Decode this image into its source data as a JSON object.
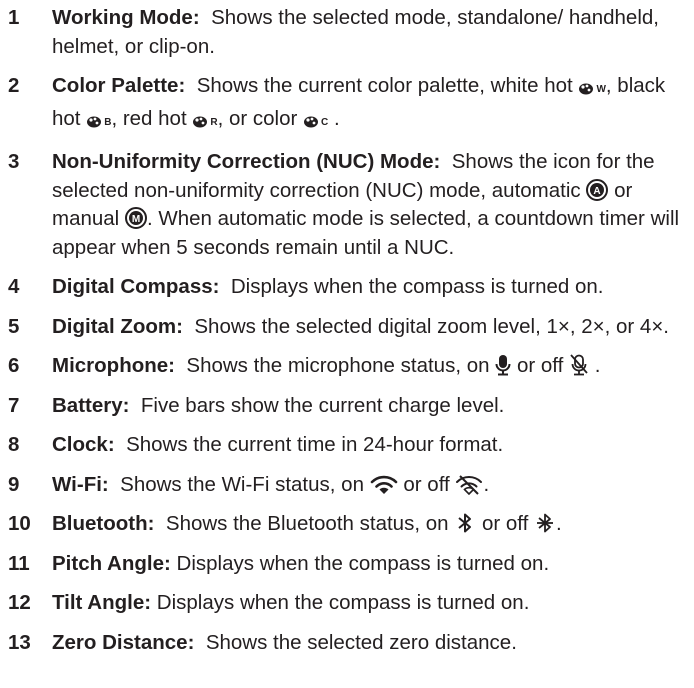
{
  "items": [
    {
      "num": "1",
      "label": "Working Mode:",
      "text": "Shows the selected mode, standalone/ handheld, helmet, or clip-on."
    },
    {
      "num": "2",
      "label": "Color Palette:",
      "t1": "Shows the current color palette, white hot",
      "t2": ",",
      "t3": "black hot",
      "t4": ", red hot",
      "t5": ", or color",
      "t6": ".",
      "icons": {
        "white": "W",
        "black": "B",
        "red": "R",
        "color": "C"
      }
    },
    {
      "num": "3",
      "label": "Non-Uniformity Correction (NUC) Mode:",
      "t1": "Shows the icon for the selected non-uniformity correction (NUC) mode,",
      "t2": "automatic",
      "t3": "or manual",
      "t4": ". When automatic mode is selected, a countdown timer will appear when 5 seconds remain until a NUC.",
      "icons": {
        "auto": "A",
        "manual": "M"
      }
    },
    {
      "num": "4",
      "label": "Digital Compass:",
      "text": "Displays when the compass is turned on."
    },
    {
      "num": "5",
      "label": "Digital Zoom:",
      "text": "Shows the selected digital zoom level, 1×, 2×, or 4×."
    },
    {
      "num": "6",
      "label": "Microphone:",
      "t1": "Shows the microphone status, on",
      "t2": "or off",
      "t3": "."
    },
    {
      "num": "7",
      "label": "Battery:",
      "text": "Five bars show the current charge level."
    },
    {
      "num": "8",
      "label": "Clock:",
      "text": "Shows the current time in 24-hour format."
    },
    {
      "num": "9",
      "label": "Wi-Fi:",
      "t1": "Shows the Wi-Fi status, on",
      "t2": "or off",
      "t3": "."
    },
    {
      "num": "10",
      "label": "Bluetooth:",
      "t1": "Shows the Bluetooth status, on",
      "t2": "or off",
      "t3": "."
    },
    {
      "num": "11",
      "label": "Pitch Angle:",
      "text": "Displays when the compass is turned on."
    },
    {
      "num": "12",
      "label": "Tilt Angle:",
      "text": "Displays when the compass is turned on."
    },
    {
      "num": "13",
      "label": "Zero Distance:",
      "text": "Shows the selected zero distance."
    }
  ]
}
